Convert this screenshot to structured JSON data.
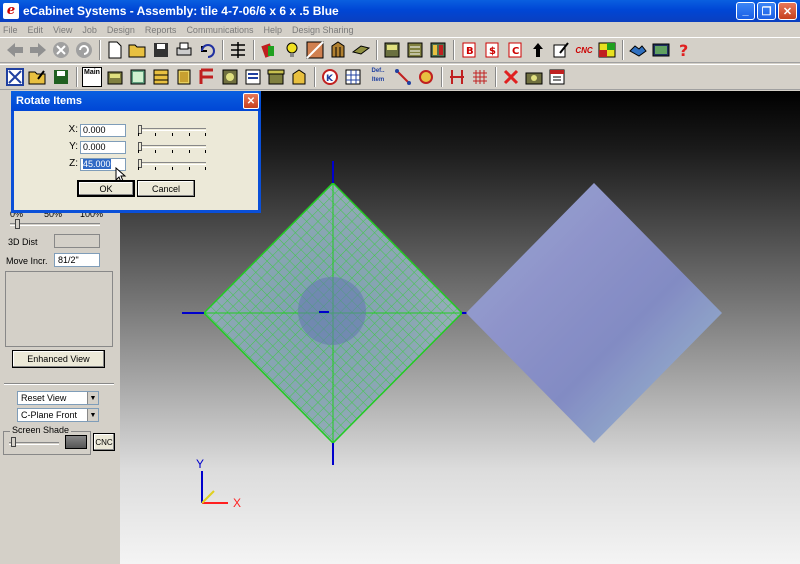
{
  "window": {
    "title": "eCabinet Systems - Assembly: tile 4-7-06/6 x 6 x .5 Blue",
    "minimize": "_",
    "restore": "❐",
    "close": "✕"
  },
  "menu": [
    "File",
    "Edit",
    "View",
    "Job",
    "Design",
    "Reports",
    "Communications",
    "Help",
    "Design Sharing"
  ],
  "toolbar2": {
    "main_label": "Main",
    "def_label": "Def.. Item",
    "cnc_label": "CNC"
  },
  "left_panel": {
    "scale_labels": [
      "0%",
      "50%",
      "100%"
    ],
    "dist_label": "3D Dist",
    "move_label": "Move Incr.",
    "move_value": "81/2\"",
    "enhanced_view_button": "Enhanced View",
    "reset_view_select": "Reset View",
    "cplane_select": "C-Plane Front",
    "screen_shade_label": "Screen Shade",
    "cnc_button": "CNC"
  },
  "dialog": {
    "title": "Rotate Items",
    "close": "✕",
    "x_label": "X:",
    "x_value": "0.000",
    "y_label": "Y:",
    "y_value": "0.000",
    "z_label": "Z:",
    "z_value": "45.000",
    "ok_label": "OK",
    "cancel_label": "Cancel"
  },
  "axes": {
    "x_label": "X",
    "y_label": "Y"
  },
  "colors": {
    "titlebar": "#0046d5",
    "grid_green": "#22cc22",
    "axis_red": "#ff2020",
    "axis_blue": "#0000cc"
  }
}
